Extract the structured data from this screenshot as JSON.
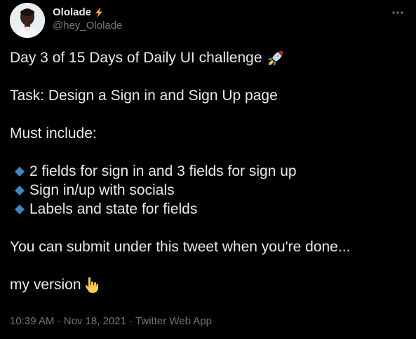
{
  "author": {
    "display_name": "Ololade",
    "handle": "@hey_Ololade",
    "avatar_icon": "user-avatar",
    "badge_icon": "lightning-icon"
  },
  "tweet": {
    "lines": [
      "Day 3 of 15 Days of Daily UI challenge",
      "Task: Design a Sign in and Sign Up page",
      "Must include:",
      "2 fields for sign in and 3 fields for sign up",
      "Sign in/up with socials",
      "Labels and state for fields",
      "You can submit under this tweet when you're done...",
      "my version"
    ],
    "emoji_rocket": "rocket-icon",
    "emoji_point_down": "point-down-icon",
    "bullet_icon": "blue-diamond-icon"
  },
  "meta": {
    "time": "10:39 AM",
    "separator": "·",
    "date": "Nov 18, 2021",
    "source": "Twitter Web App"
  },
  "colors": {
    "background": "#000000",
    "text_primary": "#e7e9ea",
    "text_secondary": "#71767b",
    "bullet_blue": "#3b88c3",
    "lightning": "#ffac33"
  }
}
